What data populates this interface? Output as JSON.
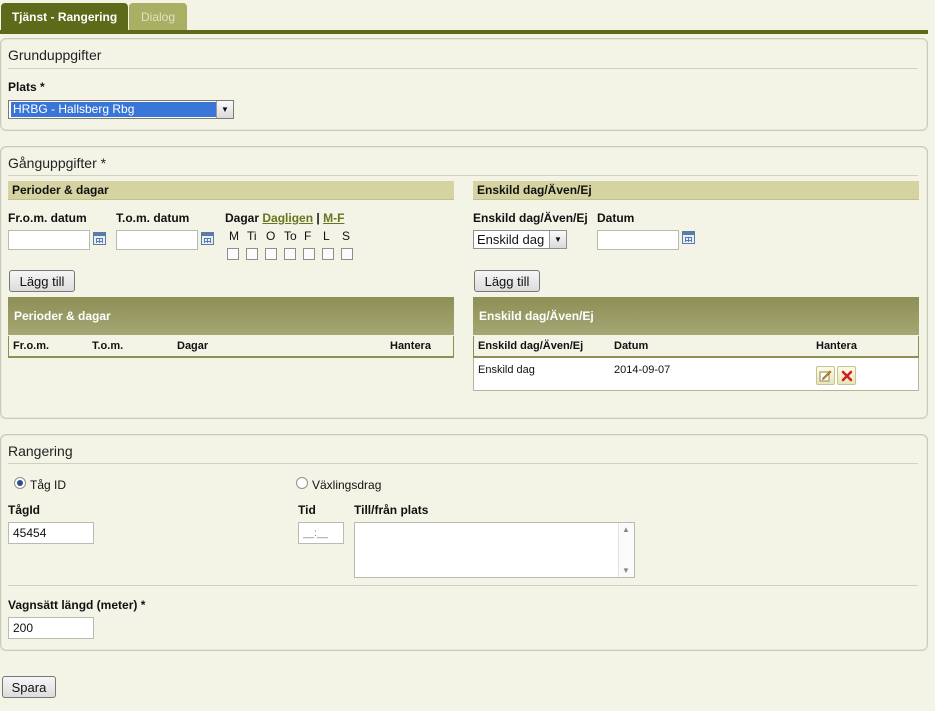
{
  "tabs": [
    {
      "label": "Tjänst - Rangering",
      "active": true
    },
    {
      "label": "Dialog",
      "active": false
    }
  ],
  "grund": {
    "title": "Grunduppgifter",
    "plats_label": "Plats *",
    "plats_value": "HRBG - Hallsberg Rbg"
  },
  "gang": {
    "title": "Gånguppgifter *",
    "perioder": {
      "bar_title": "Perioder & dagar",
      "from_label": "Fr.o.m. datum",
      "tom_label": "T.o.m. datum",
      "dagar_label": "Dagar",
      "dagligen_link": "Dagligen",
      "sep": "|",
      "mf_link": "M-F",
      "days": [
        "M",
        "Ti",
        "O",
        "To",
        "F",
        "L",
        "S"
      ],
      "add_button": "Lägg till",
      "grid_title": "Perioder & dagar",
      "columns": [
        "Fr.o.m.",
        "T.o.m.",
        "Dagar",
        "Hantera"
      ]
    },
    "enskild": {
      "bar_title": "Enskild dag/Även/Ej",
      "type_label": "Enskild dag/Även/Ej",
      "type_value": "Enskild dag",
      "datum_label": "Datum",
      "add_button": "Lägg till",
      "grid_title": "Enskild dag/Även/Ej",
      "columns": [
        "Enskild dag/Även/Ej",
        "Datum",
        "Hantera"
      ],
      "rows": [
        {
          "type": "Enskild dag",
          "datum": "2014-09-07"
        }
      ]
    }
  },
  "rangering": {
    "title": "Rangering",
    "radio_tag": "Tåg ID",
    "radio_vaxling": "Växlingsdrag",
    "tagid_label": "TågId",
    "tagid_value": "45454",
    "tid_label": "Tid",
    "tid_placeholder": "__:__",
    "till_label": "Till/från plats",
    "vagn_label": "Vagnsätt längd (meter) *",
    "vagn_value": "200"
  },
  "spara_button": "Spara"
}
